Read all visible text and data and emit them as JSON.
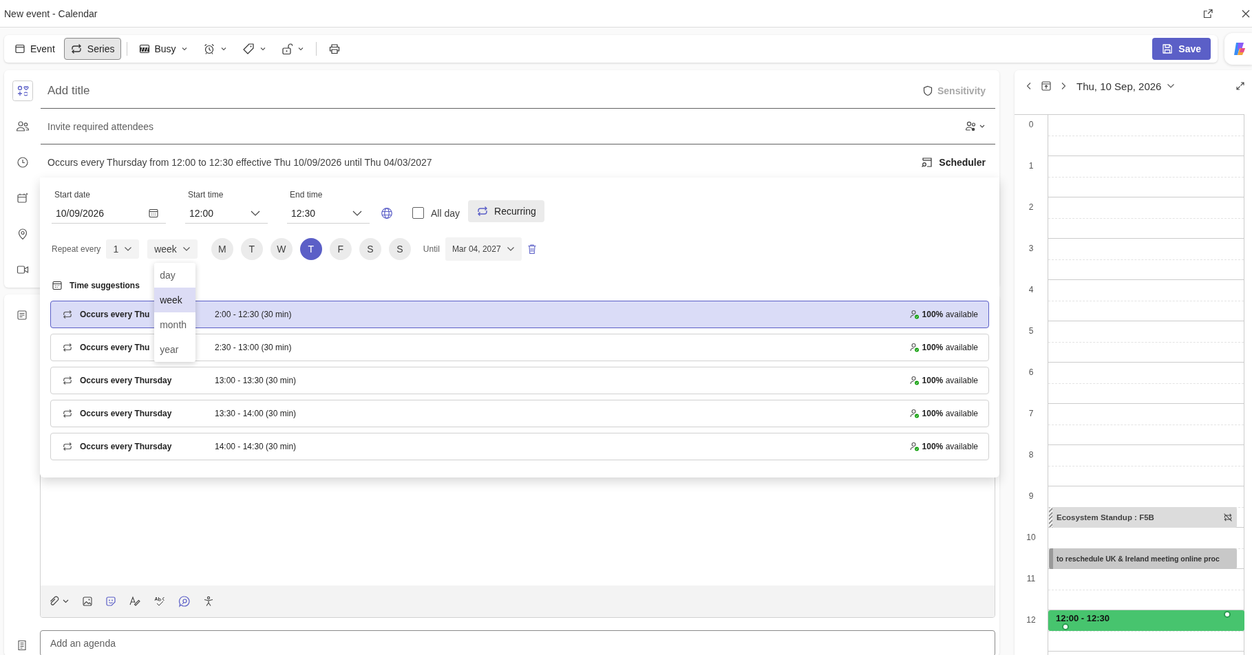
{
  "window": {
    "title": "New event - Calendar"
  },
  "toolbar": {
    "buttons": [
      {
        "kind": "event",
        "label": "Event",
        "selected": false
      },
      {
        "kind": "series",
        "label": "Series",
        "selected": true
      }
    ],
    "show_as": "Busy",
    "save": "Save"
  },
  "form": {
    "title_placeholder": "Add title",
    "sensitivity": "Sensitivity",
    "attendees_placeholder": "Invite required attendees",
    "recurrence_summary": "Occurs every Thursday from 12:00 to 12:30 effective Thu 10/09/2026 until Thu 04/03/2027",
    "scheduler": "Scheduler"
  },
  "popup": {
    "start_date": {
      "label": "Start date",
      "value": "10/09/2026"
    },
    "start_time": {
      "label": "Start time",
      "value": "12:00"
    },
    "end_time": {
      "label": "End time",
      "value": "12:30"
    },
    "all_day": {
      "label": "All day",
      "checked": false
    },
    "recurring": "Recurring",
    "repeat": {
      "label": "Repeat every",
      "interval": "1",
      "unit": "week",
      "unit_options": [
        {
          "label": "day",
          "selected": false
        },
        {
          "label": "week",
          "selected": true
        },
        {
          "label": "month",
          "selected": false
        },
        {
          "label": "year",
          "selected": false
        }
      ],
      "days": [
        {
          "label": "M",
          "selected": false
        },
        {
          "label": "T",
          "selected": false
        },
        {
          "label": "W",
          "selected": false
        },
        {
          "label": "T",
          "selected": true
        },
        {
          "label": "F",
          "selected": false
        },
        {
          "label": "S",
          "selected": false
        },
        {
          "label": "S",
          "selected": false
        }
      ],
      "until_label": "Until",
      "until_value": "Mar 04, 2027"
    },
    "suggestions_title": "Time suggestions",
    "suggestions": [
      {
        "pattern": "Occurs every Thu",
        "time": "2:00 - 12:30 (30 min)",
        "availability": "**100%** available",
        "selected": true
      },
      {
        "pattern": "Occurs every Thu",
        "time": "2:30 - 13:00 (30 min)",
        "availability": "**100%** available",
        "selected": false
      },
      {
        "pattern": "Occurs every Thursday",
        "time": "13:00 - 13:30 (30 min)",
        "availability": "**100%** available",
        "selected": false
      },
      {
        "pattern": "Occurs every Thursday",
        "time": "13:30 - 14:00 (30 min)",
        "availability": "**100%** available",
        "selected": false
      },
      {
        "pattern": "Occurs every Thursday",
        "time": "14:00 - 14:30 (30 min)",
        "availability": "**100%** available",
        "selected": false
      }
    ]
  },
  "agenda_placeholder": "Add an agenda",
  "calendar": {
    "date": "Thu, 10 Sep, 2026",
    "hours": [
      {
        "label": "0"
      },
      {
        "label": "1"
      },
      {
        "label": "2"
      },
      {
        "label": "3"
      },
      {
        "label": "4"
      },
      {
        "label": "5"
      },
      {
        "label": "6"
      },
      {
        "label": "7"
      },
      {
        "label": "8"
      },
      {
        "label": "9",
        "events": [
          {
            "kind": "tentative",
            "title": "Ecosystem Standup : F5B",
            "second_half": true
          }
        ]
      },
      {
        "label": "10",
        "events": [
          {
            "kind": "busy",
            "title": "to reschedule UK & Ireland meeting online proc",
            "second_half": true
          }
        ]
      },
      {
        "label": "11"
      },
      {
        "label": "12",
        "events": [
          {
            "kind": "new",
            "title": "12:00 - 12:30",
            "second_half": false
          }
        ]
      }
    ]
  }
}
